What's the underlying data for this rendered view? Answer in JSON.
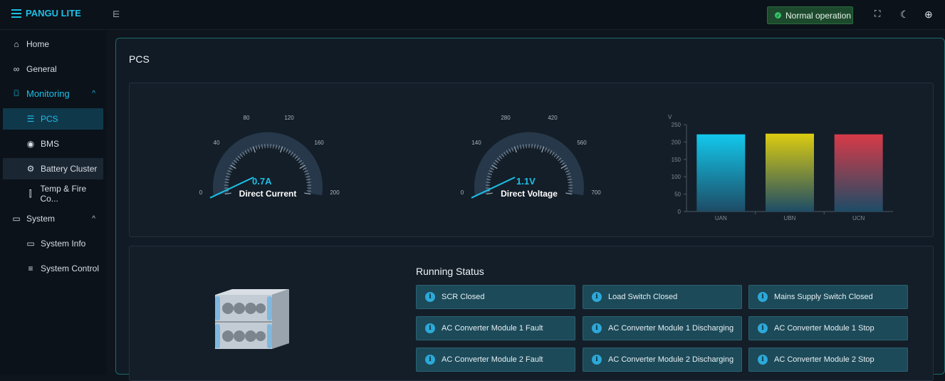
{
  "app": {
    "title": "PANGU LITE"
  },
  "topbar": {
    "status_label": "Normal operation",
    "icons": [
      "fullscreen-icon",
      "moon-icon",
      "globe-icon",
      "collapse-sidebar-icon"
    ]
  },
  "sidebar": {
    "items": [
      {
        "label": "Home",
        "icon": "home-icon"
      },
      {
        "label": "General",
        "icon": "grid-icon"
      },
      {
        "label": "Monitoring",
        "icon": "monitoring-icon"
      },
      {
        "label": "PCS",
        "icon": "pcs-icon"
      },
      {
        "label": "BMS",
        "icon": "bms-icon"
      },
      {
        "label": "Battery Cluster",
        "icon": "battery-cluster-icon"
      },
      {
        "label": "Temp & Fire Co...",
        "icon": "thermometer-icon"
      },
      {
        "label": "System",
        "icon": "system-icon"
      },
      {
        "label": "System Info",
        "icon": "monitor-icon"
      },
      {
        "label": "System Control",
        "icon": "sliders-icon"
      }
    ]
  },
  "main": {
    "title": "PCS",
    "gauges": [
      {
        "name": "Direct Current",
        "value": 0.7,
        "value_text": "0.7A",
        "max": 200,
        "ticks": [
          "0",
          "40",
          "80",
          "120",
          "160",
          "200"
        ]
      },
      {
        "name": "Direct Voltage",
        "value": 1.1,
        "value_text": "1.1V",
        "max": 700,
        "ticks": [
          "0",
          "140",
          "280",
          "420",
          "560",
          "700"
        ]
      }
    ],
    "running_status": {
      "title": "Running Status",
      "items": [
        "SCR Closed",
        "Load Switch Closed",
        "Mains Supply Switch Closed",
        "AC Converter Module 1 Fault",
        "AC Converter Module 1 Discharging",
        "AC Converter Module 1 Stop",
        "AC Converter Module 2 Fault",
        "AC Converter Module 2 Discharging",
        "AC Converter Module 2 Stop"
      ]
    }
  },
  "chart_data": {
    "type": "bar",
    "categories": [
      "UAN",
      "UBN",
      "UCN"
    ],
    "values": [
      222,
      224,
      222
    ],
    "ylabel": "V",
    "ylim": [
      0,
      250
    ],
    "yticks": [
      "0",
      "50",
      "100",
      "150",
      "200",
      "250"
    ],
    "colors": [
      "#12c8ec",
      "#dccc10",
      "#d83a48"
    ]
  }
}
